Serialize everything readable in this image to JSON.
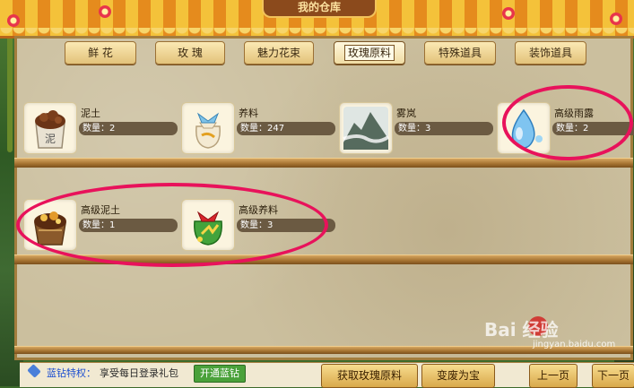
{
  "title": "我的仓库",
  "tabs": [
    {
      "label": "鲜 花"
    },
    {
      "label": "玫 瑰"
    },
    {
      "label": "魅力花束"
    },
    {
      "label": "玫瑰原料",
      "active": true
    },
    {
      "label": "特殊道具"
    },
    {
      "label": "装饰道具"
    }
  ],
  "shelf1": [
    {
      "name": "泥土",
      "qty": "数量：2",
      "icon": "soil-sack-icon",
      "icon_text": "泥"
    },
    {
      "name": "养料",
      "qty": "数量：247",
      "icon": "fertilizer-bag-icon"
    },
    {
      "name": "雾岚",
      "qty": "数量：3",
      "icon": "mountain-mist-icon"
    },
    {
      "name": "高级雨露",
      "qty": "数量：2",
      "icon": "water-drop-icon"
    }
  ],
  "shelf2": [
    {
      "name": "高级泥土",
      "qty": "数量：1",
      "icon": "premium-soil-icon"
    },
    {
      "name": "高级养料",
      "qty": "数量：3",
      "icon": "premium-fertilizer-icon"
    }
  ],
  "footer": {
    "vip_title": "蓝钻特权：",
    "vip_text": "享受每日登录礼包",
    "open_button": "开通蓝钻",
    "get_button": "获取玫瑰原料",
    "convert_button": "变废为宝",
    "prev_button": "上一页",
    "next_button": "下一页"
  },
  "watermark": {
    "brand": "Bai 经验",
    "url": "jingyan.baidu.com"
  },
  "colors": {
    "highlight_ring": "#e8125b",
    "awning_yellow": "#f4c23a",
    "awning_orange": "#e58b1d",
    "panel": "#cbbf9e"
  }
}
